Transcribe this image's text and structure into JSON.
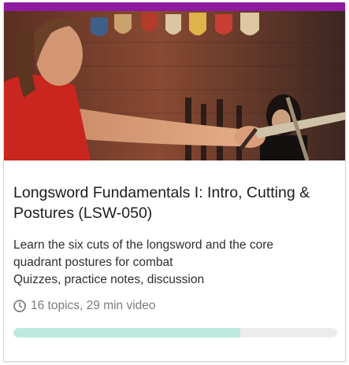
{
  "course": {
    "title": "Longsword Fundamentals I: Intro, Cutting & Postures (LSW-050)",
    "description_lines": [
      "Learn the six cuts of the longsword and the core",
      "quadrant postures for combat",
      "Quizzes, practice notes, discussion"
    ],
    "meta_text": "16 topics, 29 min video",
    "meta_icon": "clock-icon",
    "thumbnail_subject": "longsword-training-photo",
    "progress": 0.7
  },
  "colors": {
    "accent": "#8e1aa0",
    "progress_fill": "#bfe9df",
    "progress_track": "#ececec"
  }
}
